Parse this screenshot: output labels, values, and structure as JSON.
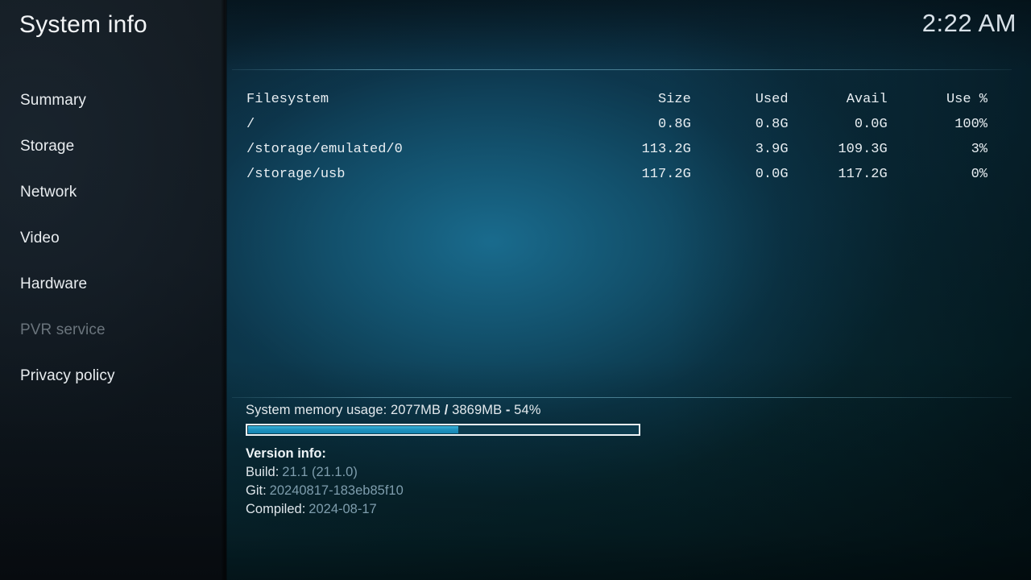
{
  "header": {
    "title": "System info",
    "clock": "2:22 AM"
  },
  "sidebar": {
    "items": [
      {
        "label": "Summary",
        "disabled": false
      },
      {
        "label": "Storage",
        "disabled": false
      },
      {
        "label": "Network",
        "disabled": false
      },
      {
        "label": "Video",
        "disabled": false
      },
      {
        "label": "Hardware",
        "disabled": false
      },
      {
        "label": "PVR service",
        "disabled": true
      },
      {
        "label": "Privacy policy",
        "disabled": false
      }
    ]
  },
  "storage": {
    "columns": [
      "Filesystem",
      "Size",
      "Used",
      "Avail",
      "Use %"
    ],
    "rows": [
      {
        "filesystem": "/",
        "size": "0.8G",
        "used": "0.8G",
        "avail": "0.0G",
        "use": "100%"
      },
      {
        "filesystem": "/storage/emulated/0",
        "size": "113.2G",
        "used": "3.9G",
        "avail": "109.3G",
        "use": "3%"
      },
      {
        "filesystem": "/storage/usb",
        "size": "117.2G",
        "used": "0.0G",
        "avail": "117.2G",
        "use": "0%"
      }
    ]
  },
  "memory": {
    "label": "System memory usage:",
    "used": "2077MB",
    "separator": "/",
    "total": "3869MB",
    "dash": "-",
    "percent_text": "54%",
    "percent_value": 54
  },
  "version": {
    "title": "Version info:",
    "build_label": "Build:",
    "build_value": "21.1 (21.1.0)",
    "git_label": "Git:",
    "git_value": "20240817-183eb85f10",
    "compiled_label": "Compiled:",
    "compiled_value": "2024-08-17"
  },
  "colors": {
    "accent": "#1f93c0",
    "separator": "#7dbed5",
    "text_primary": "#e8eef2",
    "text_dim": "#7e9dad",
    "text_disabled": "#6a747c"
  }
}
